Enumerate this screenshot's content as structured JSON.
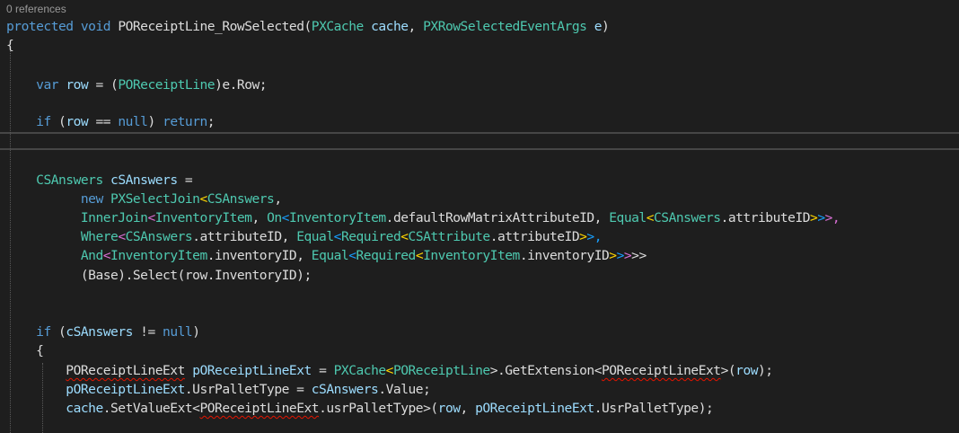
{
  "codelens": {
    "references": "0 references"
  },
  "code": {
    "l1": [
      "protected",
      "void",
      "POReceiptLine_RowSelected",
      "(",
      "PXCache",
      "cache",
      ",",
      "PXRowSelectedEventArgs",
      "e",
      ")"
    ],
    "l2": "{",
    "l3": [
      "var",
      "row",
      " = (",
      "POReceiptLine",
      ")e.Row;"
    ],
    "l4": [
      "if",
      " (",
      "row",
      " == ",
      "null",
      ") ",
      "return",
      ";"
    ],
    "l5": [
      "CSAnswers",
      "cSAnswers",
      " ="
    ],
    "l6": [
      "new",
      "PXSelectJoin",
      "<",
      "CSAnswers",
      ","
    ],
    "l7": [
      "InnerJoin",
      "<",
      "InventoryItem",
      ", ",
      "On",
      "<",
      "InventoryItem",
      ".defaultRowMatrixAttributeID, ",
      "Equal",
      "<",
      "CSAnswers",
      ".attributeID",
      ">",
      ">",
      ">,"
    ],
    "l8": [
      "Where",
      "<",
      "CSAnswers",
      ".attributeID, ",
      "Equal",
      "<",
      "Required",
      "<",
      "CSAttribute",
      ".attributeID",
      ">",
      ">,"
    ],
    "l9": [
      "And",
      "<",
      "InventoryItem",
      ".inventoryID, ",
      "Equal",
      "<",
      "Required",
      "<",
      "InventoryItem",
      ".inventoryID",
      ">",
      ">",
      ">",
      ">>"
    ],
    "l10": "(Base).Select(row.InventoryID);",
    "l11": [
      "if",
      " (",
      "cSAnswers",
      " != ",
      "null",
      ")"
    ],
    "l12": "{",
    "l13": [
      "POReceiptLineExt",
      "pOReceiptLineExt",
      " = ",
      "PXCache",
      "<",
      "POReceiptLine",
      ">.GetExtension<",
      "POReceiptLineExt",
      ">(",
      "row",
      ");"
    ],
    "l14": [
      "pOReceiptLineExt",
      ".UsrPalletType = ",
      "cSAnswers",
      ".Value;"
    ],
    "l15": [
      "cache",
      ".SetValueExt<",
      "POReceiptLineExt",
      ".usrPalletType>(",
      "row",
      ", ",
      "pOReceiptLineExt",
      ".UsrPalletType);"
    ]
  },
  "colors": {
    "background": "#1e1e1e",
    "keyword": "#569cd6",
    "type": "#4ec9b0",
    "identifier": "#9cdcfe",
    "bracket": "#ffd700",
    "bracket_pink": "#da70d6",
    "plain": "#dcdcdc",
    "error_squiggle": "#e51400"
  }
}
